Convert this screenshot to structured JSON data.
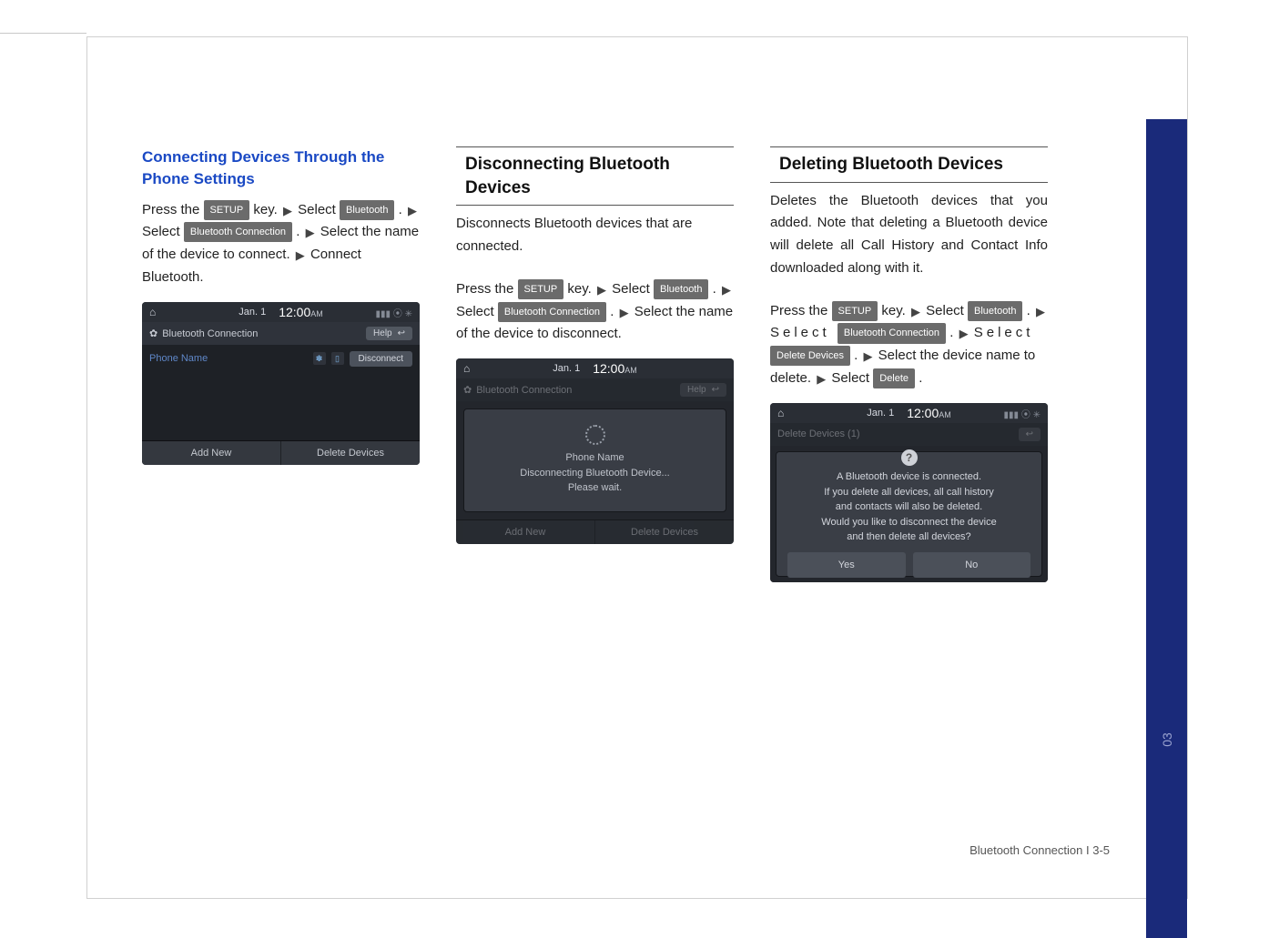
{
  "side_tab": {
    "chapter": "03"
  },
  "footer": "Bluetooth Connection I 3-5",
  "col1": {
    "heading": "Connecting Devices Through the Phone Settings",
    "step": {
      "p1": "Press the ",
      "k1": "SETUP",
      "p2": " key. ",
      "p3": " Select ",
      "k2": "Bluetooth",
      "p4": ". ",
      "p5": "Select ",
      "k3": "Bluetooth Connection",
      "p6": ".  ",
      "p7": " Select the name of the device to connect. ",
      "p8": " Connect Bluetooth."
    }
  },
  "shot1": {
    "date": "Jan.  1",
    "time": "12:00",
    "ampm": "AM",
    "title": "Bluetooth Connection",
    "help": "Help",
    "phone_name": "Phone Name",
    "disconnect": "Disconnect",
    "add_new": "Add New",
    "delete_devices": "Delete Devices"
  },
  "col2": {
    "heading": "Disconnecting Bluetooth Devices",
    "intro": "Disconnects Bluetooth devices that are connected.",
    "step": {
      "p1": "Press the ",
      "k1": "SETUP",
      "p2": " key. ",
      "p3": " Select ",
      "k2": "Bluetooth",
      "p4": ". ",
      "p5": "Select ",
      "k3": "Bluetooth Connection",
      "p6": ".   ",
      "p7": " Select the name of the device to disconnect."
    }
  },
  "shot2": {
    "date": "Jan.  1",
    "time": "12:00",
    "ampm": "AM",
    "title": "Bluetooth Connection",
    "help": "Help",
    "modal_line1": "Phone Name",
    "modal_line2": "Disconnecting Bluetooth Device...",
    "modal_line3": "Please wait.",
    "add_new": "Add New",
    "delete_devices": "Delete Devices"
  },
  "col3": {
    "heading": "Deleting Bluetooth Devices",
    "intro": "Deletes the Bluetooth devices that you added. Note that deleting a Bluetooth device will delete all Call History and Contact Info downloaded along with it.",
    "step": {
      "p1": "Press the ",
      "k1": "SETUP",
      "p2": " key. ",
      "p3": " Select ",
      "k2": "Bluetooth",
      "p4": ". ",
      "p5": "Select ",
      "k3": "Bluetooth Connection",
      "p6": ".  ",
      "p7": " Select ",
      "k4": "Delete Devices",
      "p8": ". ",
      "p9": " Select the device name to delete. ",
      "p10": " Select ",
      "k5": "Delete",
      "p11": "."
    }
  },
  "shot3": {
    "date": "Jan.  1",
    "time": "12:00",
    "ampm": "AM",
    "title": "Delete Devices (1)",
    "msg1": "A Bluetooth device is connected.",
    "msg2": "If you delete all devices, all call history",
    "msg3": "and contacts will also be deleted.",
    "msg4": "Would you like to disconnect the device",
    "msg5": "and then delete all devices?",
    "yes": "Yes",
    "no": "No"
  },
  "glyphs": {
    "arrow": "▶",
    "home": "⌂",
    "back": "↩",
    "gear": "✿",
    "sig": "▮▮▮ ⦿ ✳"
  }
}
